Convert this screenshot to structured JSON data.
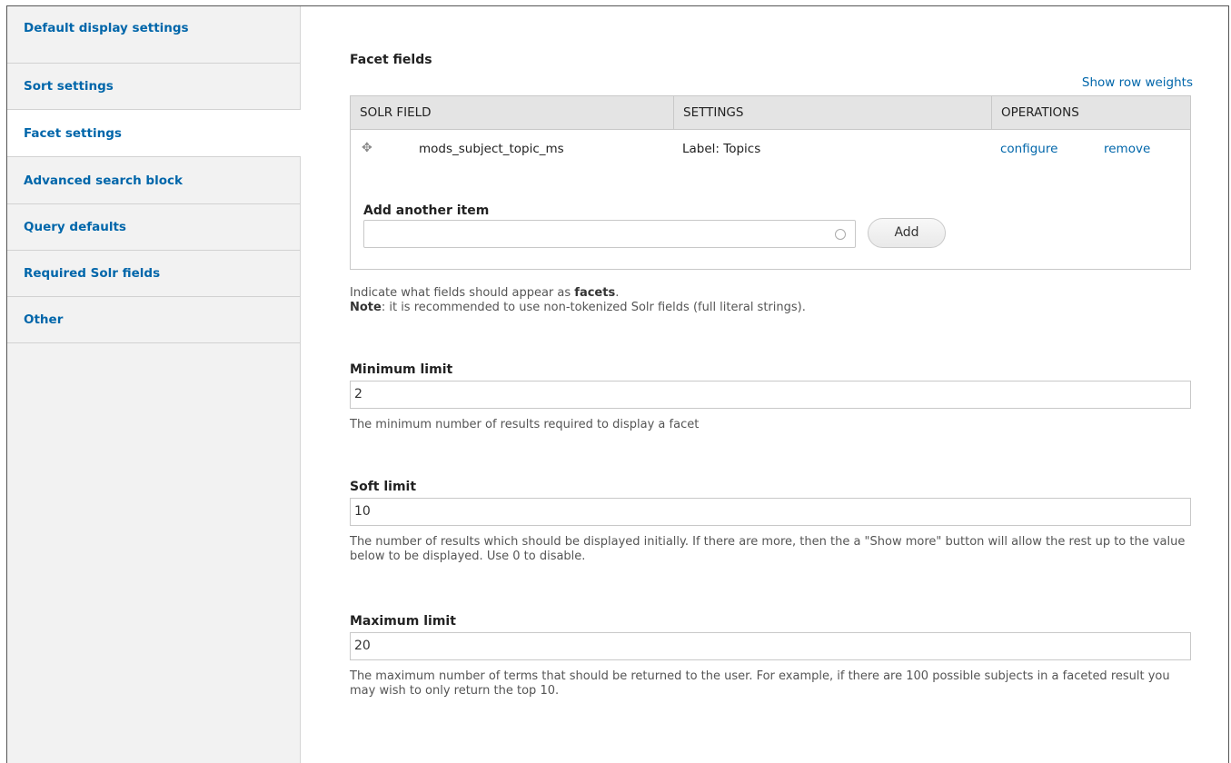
{
  "sidebar": {
    "items": [
      {
        "label": "Default display settings"
      },
      {
        "label": "Sort settings"
      },
      {
        "label": "Facet settings"
      },
      {
        "label": "Advanced search block"
      },
      {
        "label": "Query defaults"
      },
      {
        "label": "Required Solr fields"
      },
      {
        "label": "Other"
      }
    ],
    "active_index": 2
  },
  "facet_fields": {
    "title": "Facet fields",
    "show_row_weights": "Show row weights",
    "columns": [
      "SOLR FIELD",
      "SETTINGS",
      "OPERATIONS"
    ],
    "rows": [
      {
        "field": "mods_subject_topic_ms",
        "settings": "Label: Topics",
        "configure": "configure",
        "remove": "remove"
      }
    ],
    "add_label": "Add another item",
    "add_value": "",
    "add_button": "Add"
  },
  "help": {
    "line1_prefix": "Indicate what fields should appear as ",
    "line1_bold": "facets",
    "line1_suffix": ".",
    "note_label": "Note",
    "note_text": ": it is recommended to use non-tokenized Solr fields (full literal strings)."
  },
  "fields": {
    "minimum": {
      "label": "Minimum limit",
      "value": "2",
      "description": "The minimum number of results required to display a facet"
    },
    "soft": {
      "label": "Soft limit",
      "value": "10",
      "description": "The number of results which should be displayed initially. If there are more, then the a \"Show more\" button will allow the rest up to the value below to be displayed. Use 0 to disable."
    },
    "maximum": {
      "label": "Maximum limit",
      "value": "20",
      "description": "The maximum number of terms that should be returned to the user. For example, if there are 100 possible subjects in a faceted result you may wish to only return the top 10."
    }
  },
  "colors": {
    "link": "#0066aa",
    "sidebar_bg": "#f2f2f2",
    "table_header_bg": "#e4e4e4"
  }
}
